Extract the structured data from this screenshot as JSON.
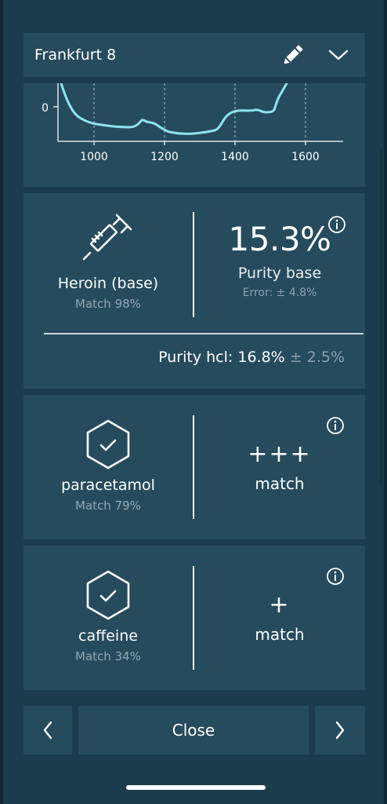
{
  "header": {
    "title": "Frankfurt 8",
    "edit_icon": "pencil-icon",
    "expand_icon": "chevron-down-icon"
  },
  "spectrum": {
    "y_tick": "0",
    "x_ticks": [
      "1000",
      "1200",
      "1400",
      "1600"
    ],
    "line_color": "#8fe3f0"
  },
  "primary": {
    "icon": "syringe-icon",
    "name": "Heroin (base)",
    "match": "Match 98%",
    "purity_value": "15.3%",
    "purity_label": "Purity base",
    "error": "Error: ± 4.8%",
    "hcl_label": "Purity hcl:",
    "hcl_value": "16.8%",
    "hcl_error": "± 2.5%"
  },
  "substances": [
    {
      "icon": "hexagon-check-icon",
      "name": "paracetamol",
      "match": "Match 79%",
      "level": "+++",
      "level_label": "match"
    },
    {
      "icon": "hexagon-check-icon",
      "name": "caffeine",
      "match": "Match 34%",
      "level": "+",
      "level_label": "match"
    }
  ],
  "footer": {
    "prev_icon": "chevron-left-icon",
    "close_label": "Close",
    "next_icon": "chevron-right-icon"
  },
  "colors": {
    "background": "#1b3c4c",
    "panel": "#264b5d",
    "muted_text": "#8aa1ad",
    "accent_line": "#8fe3f0"
  }
}
